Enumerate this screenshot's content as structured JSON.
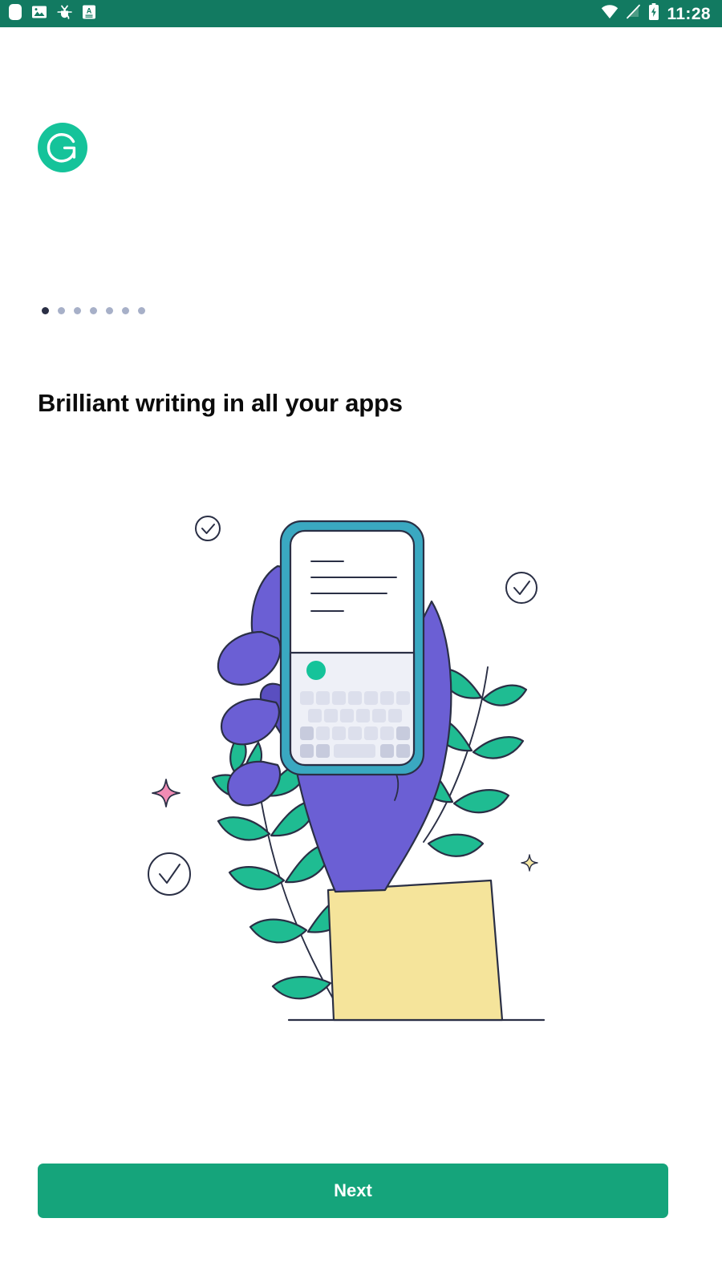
{
  "status_bar": {
    "background_color": "#127a61",
    "time": "11:28",
    "left_icons": [
      {
        "name": "notification-badge-icon",
        "glyph": "rounded-square"
      },
      {
        "name": "image-icon",
        "glyph": "photo"
      },
      {
        "name": "debug-bug-icon",
        "glyph": "bug"
      },
      {
        "name": "text-format-icon",
        "glyph": "letter-a"
      }
    ],
    "right_icons": [
      {
        "name": "wifi-icon",
        "glyph": "wifi-full"
      },
      {
        "name": "no-sim-icon",
        "glyph": "signal-off"
      },
      {
        "name": "battery-charging-icon",
        "glyph": "battery-bolt"
      }
    ]
  },
  "brand": {
    "logo_name": "grammarly-logo",
    "logo_letter": "G",
    "logo_color": "#15c39a"
  },
  "pager": {
    "total": 7,
    "active_index": 0,
    "active_color": "#2a2f45",
    "inactive_color": "#a7b0c8"
  },
  "onboarding": {
    "headline": "Brilliant writing in all your apps",
    "illustration_name": "hand-holding-phone-illustration",
    "illustration_elements": [
      "check-circle-icon",
      "check-circle-icon",
      "check-circle-icon",
      "pink-sparkle-icon",
      "yellow-sparkle-icon",
      "leaf-plant-left",
      "leaf-plant-right",
      "smartphone-with-keyboard",
      "purple-hand",
      "yellow-sleeve"
    ]
  },
  "footer": {
    "next_label": "Next",
    "next_color": "#15a47b"
  },
  "colors": {
    "brand_green": "#15c39a",
    "button_green": "#15a47b",
    "status_green": "#127a61",
    "ink": "#2a2f45",
    "purple": "#6b5fd4",
    "purple_dark": "#5a4fc0",
    "teal": "#3aa8c1",
    "yellow": "#f5e49b",
    "plant_green": "#1fbc92",
    "pink": "#f08cb4",
    "key_light": "#dcdfec",
    "key_dark": "#c7cbdd",
    "keyboard_bg": "#eef0f7"
  }
}
